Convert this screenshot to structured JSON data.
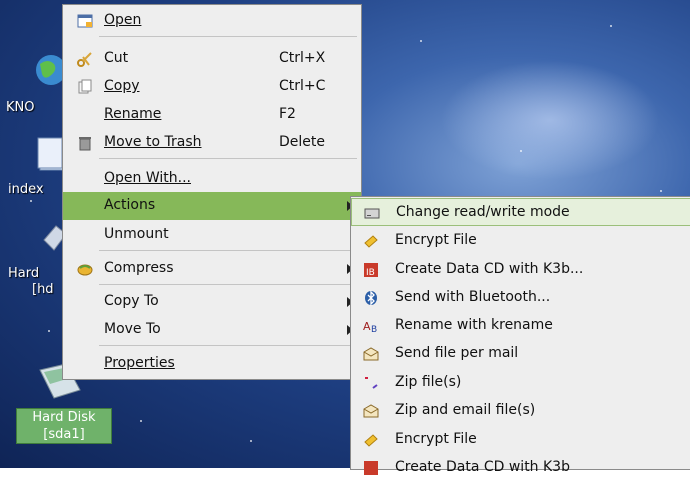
{
  "desktop": {
    "icons": [
      {
        "label": "KNO"
      },
      {
        "label": "index"
      },
      {
        "label": "Hard"
      },
      {
        "label": "[hd"
      }
    ],
    "hard_disk": {
      "line1": "Hard Disk",
      "line2": "[sda1]"
    }
  },
  "context_menu": {
    "open": "Open",
    "cut": "Cut",
    "cut_shortcut": "Ctrl+X",
    "copy": "Copy",
    "copy_shortcut": "Ctrl+C",
    "rename": "Rename",
    "rename_shortcut": "F2",
    "move_to_trash": "Move to Trash",
    "move_to_trash_shortcut": "Delete",
    "open_with": "Open With...",
    "actions": "Actions",
    "unmount": "Unmount",
    "compress": "Compress",
    "copy_to": "Copy To",
    "move_to": "Move To",
    "properties": "Properties"
  },
  "actions_submenu": {
    "items": [
      {
        "label": "Change read/write mode",
        "icon": "drive-icon"
      },
      {
        "label": "Encrypt File",
        "icon": "encrypt-icon"
      },
      {
        "label": "Create Data CD with K3b...",
        "icon": "k3b-icon"
      },
      {
        "label": "Send with Bluetooth...",
        "icon": "bluetooth-icon"
      },
      {
        "label": "Rename with krename",
        "icon": "krename-icon"
      },
      {
        "label": "Send file per mail",
        "icon": "mail-icon"
      },
      {
        "label": "Zip file(s)",
        "icon": "zip-icon"
      },
      {
        "label": "Zip and email file(s)",
        "icon": "zip-mail-icon"
      },
      {
        "label": "Encrypt File",
        "icon": "encrypt-icon"
      },
      {
        "label": "Create Data CD with K3b",
        "icon": "k3b-icon"
      }
    ]
  },
  "colors": {
    "highlight": "#86b859",
    "menu_bg": "#eeeeee",
    "selection_label": "#6fb26a"
  }
}
